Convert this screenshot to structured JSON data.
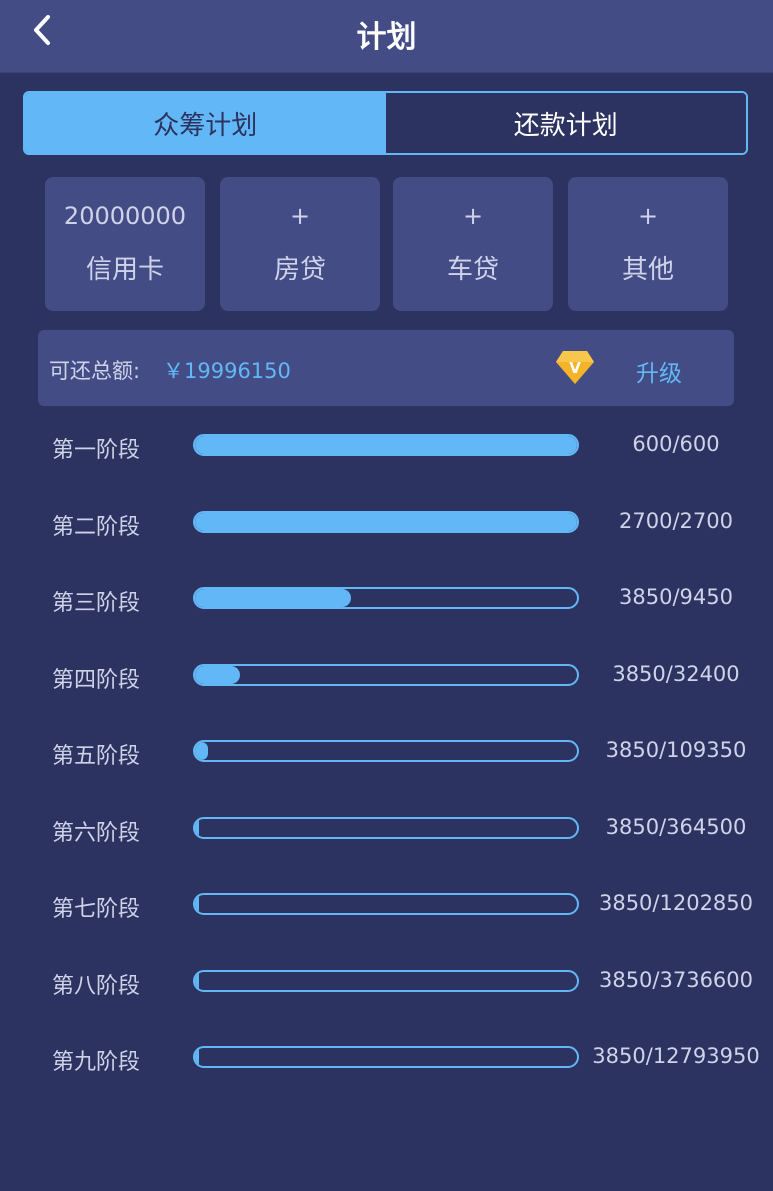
{
  "header": {
    "title": "计划",
    "back_icon": "chevron-left-icon"
  },
  "tabs": [
    {
      "label": "众筹计划",
      "active": true
    },
    {
      "label": "还款计划",
      "active": false
    }
  ],
  "cards": [
    {
      "top": "20000000",
      "label": "信用卡"
    },
    {
      "top": "+",
      "label": "房贷"
    },
    {
      "top": "+",
      "label": "车贷"
    },
    {
      "top": "+",
      "label": "其他"
    }
  ],
  "total": {
    "label": "可还总额:",
    "value": "￥19996150",
    "upgrade_icon": "diamond-icon",
    "upgrade_label": "升级"
  },
  "stages": [
    {
      "label": "第一阶段",
      "value": "600/600",
      "progress": 1.0
    },
    {
      "label": "第二阶段",
      "value": "2700/2700",
      "progress": 1.0
    },
    {
      "label": "第三阶段",
      "value": "3850/9450",
      "progress": 0.4074
    },
    {
      "label": "第四阶段",
      "value": "3850/32400",
      "progress": 0.1188
    },
    {
      "label": "第五阶段",
      "value": "3850/109350",
      "progress": 0.0352
    },
    {
      "label": "第六阶段",
      "value": "3850/364500",
      "progress": 0.0106
    },
    {
      "label": "第七阶段",
      "value": "3850/1202850",
      "progress": 0.0032
    },
    {
      "label": "第八阶段",
      "value": "3850/3736600",
      "progress": 0.001
    },
    {
      "label": "第九阶段",
      "value": "3850/12793950",
      "progress": 0.0003
    }
  ],
  "colors": {
    "background": "#2c3360",
    "panel": "#444c86",
    "accent": "#62b8f6",
    "badge": "#f5b327"
  }
}
